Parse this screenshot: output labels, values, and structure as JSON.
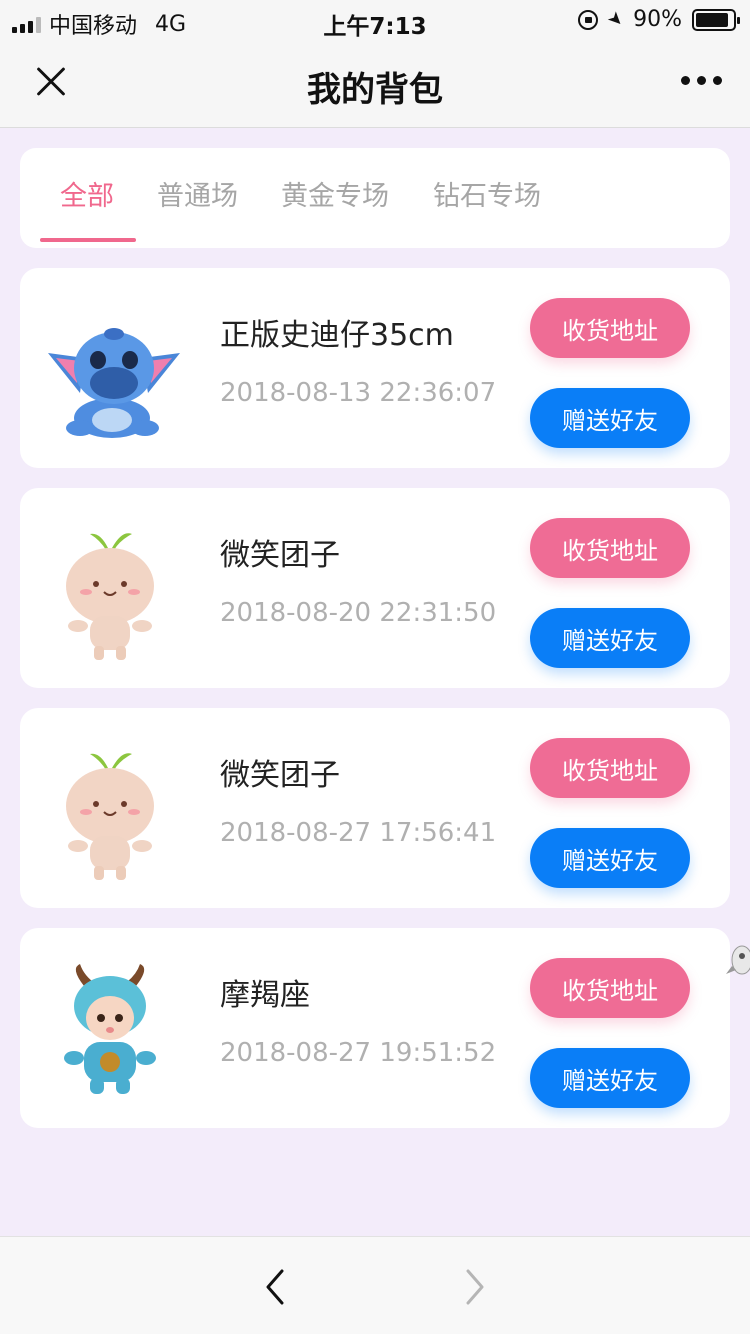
{
  "status_bar": {
    "carrier": "中国移动",
    "network": "4G",
    "time": "上午7:13",
    "battery": "90%",
    "battery_level": 0.9
  },
  "nav": {
    "title": "我的背包",
    "close_icon": "close-icon",
    "more_icon": "more-icon"
  },
  "tabs": [
    {
      "label": "全部",
      "active": true
    },
    {
      "label": "普通场",
      "active": false
    },
    {
      "label": "黄金专场",
      "active": false
    },
    {
      "label": "钻石专场",
      "active": false
    }
  ],
  "items": [
    {
      "name": "正版史迪仔35cm",
      "date": "2018-08-13 22:36:07",
      "address_label": "收货地址",
      "gift_label": "赠送好友",
      "image": "stitch-plush"
    },
    {
      "name": "微笑团子",
      "date": "2018-08-20 22:31:50",
      "address_label": "收货地址",
      "gift_label": "赠送好友",
      "image": "smile-dumpling-plush"
    },
    {
      "name": "微笑团子",
      "date": "2018-08-27 17:56:41",
      "address_label": "收货地址",
      "gift_label": "赠送好友",
      "image": "smile-dumpling-plush"
    },
    {
      "name": "摩羯座",
      "date": "2018-08-27 19:51:52",
      "address_label": "收货地址",
      "gift_label": "赠送好友",
      "image": "capricorn-doll"
    }
  ],
  "colors": {
    "accent_pink": "#ef6c95",
    "accent_blue": "#0a7ef7",
    "page_bg": "#f3ecfa"
  },
  "bottom_bar": {
    "back_icon": "chevron-left-icon",
    "forward_icon": "chevron-right-icon"
  }
}
